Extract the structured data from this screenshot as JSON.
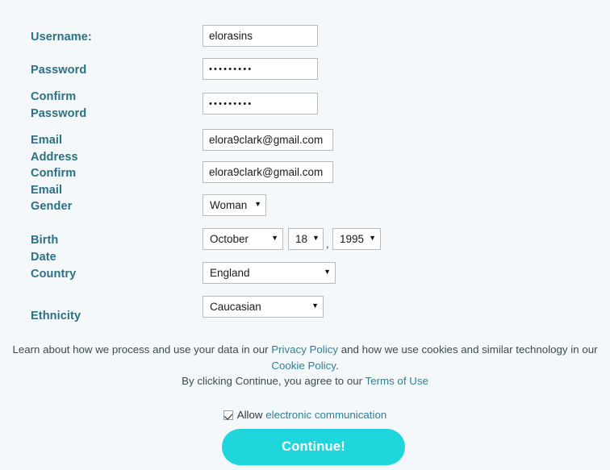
{
  "form": {
    "fields": [
      {
        "id": "username",
        "label": "Username:",
        "type": "text",
        "value": "elorasins"
      },
      {
        "id": "password",
        "label": "Password",
        "type": "password",
        "value": "•••••••••"
      },
      {
        "id": "confirm-password",
        "label": "Confirm\nPassword",
        "type": "password",
        "value": "•••••••••"
      },
      {
        "id": "email",
        "label": "Email Address",
        "type": "text",
        "value": "elora9clark@gmail.com"
      },
      {
        "id": "confirm-email",
        "label": "Confirm Email",
        "type": "text",
        "value": "elora9clark@gmail.com"
      },
      {
        "id": "gender",
        "label": "Gender",
        "type": "select",
        "value": "Woman"
      },
      {
        "id": "birth-date",
        "label": "Birth Date",
        "type": "date-group"
      },
      {
        "id": "country",
        "label": "Country",
        "type": "select",
        "value": "England"
      },
      {
        "id": "ethnicity",
        "label": "Ethnicity",
        "type": "select",
        "value": "Caucasian"
      }
    ],
    "birth_date": {
      "month": "October",
      "day": "18",
      "year": "1995",
      "separator": ","
    },
    "caret_glyph": "▼"
  },
  "legal": {
    "line1_a": "Learn about how we process and use your data in our ",
    "privacy_policy": "Privacy Policy",
    "line1_b": " and how we use cookies and similar technology in our ",
    "cookie_policy": "Cookie Policy",
    "line1_c": ".",
    "line2_a": "By clicking Continue, you agree to our ",
    "terms_of_use": "Terms of Use"
  },
  "consent": {
    "checked": true,
    "prefix": "Allow ",
    "link": "electronic communication"
  },
  "cta": {
    "label": "Continue!"
  },
  "colors": {
    "page_background": "#f4f8fa",
    "label": "#2b7084",
    "link": "#2f7f98",
    "button": "#1ed6db",
    "button_text": "#ffffff",
    "field_border": "#b9bcbe"
  }
}
